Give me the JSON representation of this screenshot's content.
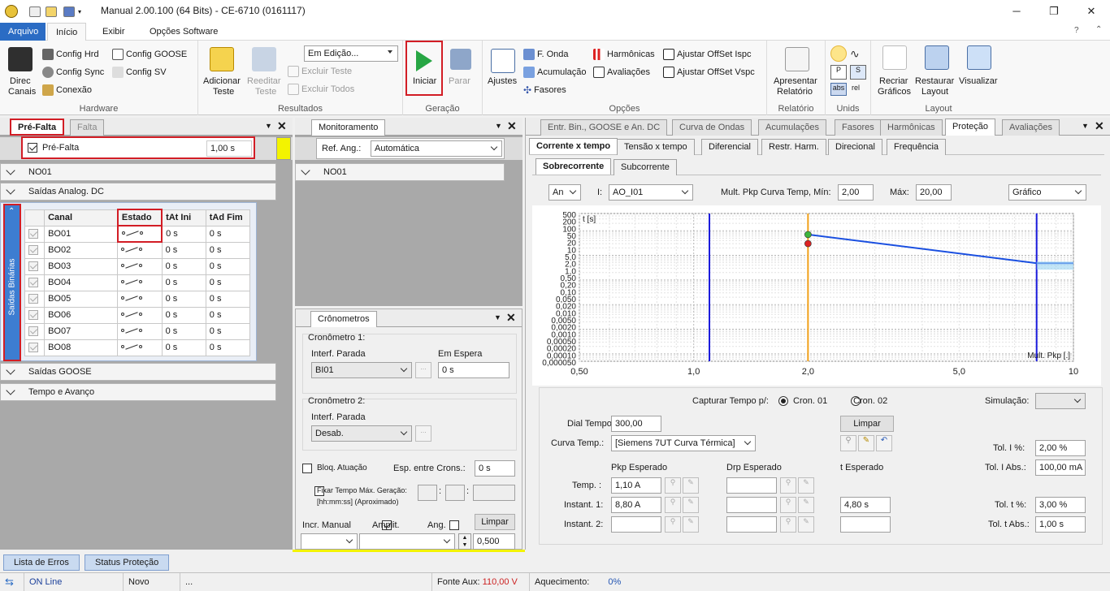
{
  "window": {
    "title": "Manual 2.00.100 (64 Bits) - CE-6710 (0161117)"
  },
  "menu": {
    "tabs": [
      "Arquivo",
      "Início",
      "Exibir",
      "Opções Software"
    ]
  },
  "ribbon": {
    "hardware": {
      "label": "Hardware",
      "direc": "Direc",
      "canais": "Canais",
      "config_hrd": "Config Hrd",
      "config_sync": "Config Sync",
      "conexao": "Conexão",
      "config_goose": "Config GOOSE",
      "config_sv": "Config SV"
    },
    "resultados": {
      "label": "Resultados",
      "adicionar": "Adicionar",
      "teste1": "Teste",
      "reeditar": "Reeditar",
      "teste2": "Teste",
      "modo": "Em Edição...",
      "excluir_teste": "Excluir Teste",
      "excluir_todos": "Excluir Todos"
    },
    "geracao": {
      "label": "Geração",
      "iniciar": "Iniciar",
      "parar": "Parar"
    },
    "opcoes": {
      "label": "Opções",
      "ajustes": "Ajustes",
      "f_onda": "F. Onda",
      "acumulacao": "Acumulação",
      "fasores": "Fasores",
      "harmonicas": "Harmônicas",
      "avaliacoes": "Avaliações",
      "offset_ispc": "Ajustar OffSet Ispc",
      "offset_vspc": "Ajustar OffSet Vspc"
    },
    "relatorio": {
      "label": "Relatório",
      "apresentar": "Apresentar",
      "relatorio": "Relatório"
    },
    "unids": {
      "label": "Unids",
      "abs": "abs",
      "rel": "rel"
    },
    "layout": {
      "label": "Layout",
      "recriar": "Recriar",
      "graficos": "Gráficos",
      "restaurar": "Restaurar",
      "layout": "Layout",
      "visualizar": "Visualizar"
    }
  },
  "left": {
    "tabs": [
      "Pré-Falta",
      "Falta"
    ],
    "prefalta_label": "Pré-Falta",
    "prefalta_time": "1,00 s",
    "sections": [
      "NO01",
      "Saídas Analog. DC",
      "Saídas GOOSE",
      "Tempo e Avanço"
    ],
    "side_label": "Saídas Binárias",
    "columns": [
      "Canal",
      "Estado",
      "tAt Ini",
      "tAd Fim"
    ],
    "rows": [
      {
        "canal": "BO01",
        "tai": "0 s",
        "taf": "0 s"
      },
      {
        "canal": "BO02",
        "tai": "0 s",
        "taf": "0 s"
      },
      {
        "canal": "BO03",
        "tai": "0 s",
        "taf": "0 s"
      },
      {
        "canal": "BO04",
        "tai": "0 s",
        "taf": "0 s"
      },
      {
        "canal": "BO05",
        "tai": "0 s",
        "taf": "0 s"
      },
      {
        "canal": "BO06",
        "tai": "0 s",
        "taf": "0 s"
      },
      {
        "canal": "BO07",
        "tai": "0 s",
        "taf": "0 s"
      },
      {
        "canal": "BO08",
        "tai": "0 s",
        "taf": "0 s"
      }
    ]
  },
  "monitor": {
    "tab": "Monitoramento",
    "ref_label": "Ref. Ang.:",
    "ref_value": "Automática",
    "section": "NO01"
  },
  "crono": {
    "tab": "Crônometros",
    "c1": "Cronômetro 1:",
    "c1_interf_label": "Interf. Parada",
    "c1_interf": "BI01",
    "espera_label": "Em Espera",
    "espera_value": "0 s",
    "c2": "Cronômetro 2:",
    "c2_interf_label": "Interf. Parada",
    "c2_interf": "Desab.",
    "bloq": "Bloq. Atuação",
    "esp_label": "Esp. entre Crons.:",
    "esp_value": "0 s",
    "fixar": "Fixar Tempo Máx. Geração:",
    "fixar_hint": "[hh:mm:ss] (Aproximado)",
    "incr": "Incr. Manual",
    "amplit": "Amplit.",
    "ang": "Ang.",
    "limpar": "Limpar",
    "step": "0,500"
  },
  "right": {
    "tabs": [
      "Entr. Bin., GOOSE e An. DC",
      "Curva de Ondas",
      "Acumulações",
      "Fasores",
      "Harmônicas",
      "Proteção",
      "Avaliações"
    ],
    "subtabs": [
      "Corrente x tempo",
      "Tensão x tempo",
      "Diferencial",
      "Restr. Harm.",
      "Direcional",
      "Frequência"
    ],
    "subsubtabs": [
      "Sobrecorrente",
      "Subcorrente"
    ],
    "an": "An",
    "i_label": "I:",
    "i_value": "AO_I01",
    "mult_label": "Mult. Pkp Curva Temp, Mín:",
    "mult_min": "2,00",
    "max_label": "Máx:",
    "mult_max": "20,00",
    "view": "Gráfico",
    "capturar": "Capturar Tempo p/:",
    "cron1": "Cron. 01",
    "cron2": "Cron. 02",
    "simulacao": "Simulação:",
    "limpar": "Limpar",
    "dial_label": "Dial Tempo:",
    "dial": "300,00",
    "curva_label": "Curva Temp.:",
    "curva": "[Siemens 7UT Curva Térmica]",
    "tol_i_pct_label": "Tol. I %:",
    "tol_i_pct": "2,00 %",
    "tol_i_abs_label": "Tol. I Abs.:",
    "tol_i_abs": "100,00 mA",
    "pkp_label": "Pkp Esperado",
    "drp_label": "Drp Esperado",
    "t_label": "t Esperado",
    "temp_label": "Temp. :",
    "temp_pkp": "1,10 A",
    "inst1_label": "Instant. 1:",
    "inst1_pkp": "8,80 A",
    "inst1_t": "4,80 s",
    "inst2_label": "Instant. 2:",
    "tol_t_pct_label": "Tol. t %:",
    "tol_t_pct": "3,00 %",
    "tol_t_abs_label": "Tol. t Abs.:",
    "tol_t_abs": "1,00 s"
  },
  "chart_data": {
    "type": "line",
    "title": "",
    "xlabel": "Mult. Pkp [.]",
    "ylabel": "t [s]",
    "xscale": "log",
    "yscale": "log",
    "xlim": [
      0.5,
      10
    ],
    "ylim": [
      0.0005,
      500
    ],
    "x_ticks": [
      "0,50",
      "1,0",
      "2,0",
      "5,0",
      "10"
    ],
    "y_ticks": [
      "500",
      "200",
      "100",
      "50",
      "20",
      "10",
      "5,0",
      "2,0",
      "1,0",
      "0,50",
      "0,20",
      "0,10",
      "0,050",
      "0,020",
      "0,010",
      "0,0050",
      "0,0020",
      "0,0010",
      "0,00050",
      "0,00020",
      "0,00010",
      "0,000050"
    ],
    "series": [
      {
        "values": [
          [
            2.0,
            70
          ],
          [
            8.0,
            4.8
          ]
        ]
      }
    ],
    "markers": {
      "vlines": [
        {
          "x": 1.1,
          "color": "#1a1adc"
        },
        {
          "x": 2.0,
          "color": "#f2a11a"
        },
        {
          "x": 8.0,
          "color": "#1a1adc"
        }
      ],
      "points": [
        {
          "x": 2.0,
          "y": 70,
          "color": "#3db53d"
        },
        {
          "x": 2.0,
          "y": 30,
          "color": "#d22"
        }
      ]
    },
    "grid": true
  },
  "bottom": {
    "tabs": [
      "Lista de Erros",
      "Status Proteção"
    ]
  },
  "status": {
    "online": "ON Line",
    "mode": "Novo",
    "dots": "...",
    "fonte_label": "Fonte Aux:",
    "fonte_value": "110,00 V",
    "aquec_label": "Aquecimento:",
    "aquec_value": "0%"
  },
  "colors": {
    "accent": "#2b6cc4",
    "highlight": "#d21d25",
    "yellow": "#f3f300"
  }
}
